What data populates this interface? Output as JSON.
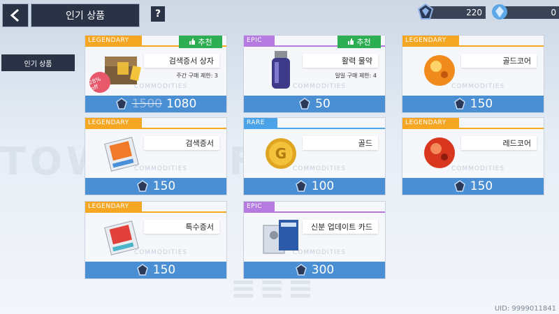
{
  "header": {
    "title": "인기 상품",
    "help_label": "?",
    "currency_1": {
      "value": "220",
      "icon": "blue-crystal-icon"
    },
    "currency_2": {
      "value": "0",
      "icon": "diamond-icon"
    }
  },
  "sidebar": {
    "items": [
      {
        "label": "인기 상품"
      }
    ]
  },
  "cards": [
    {
      "rarity": "LEGENDARY",
      "name": "검색증서 상자",
      "limit": "주간 구매 제한: 3",
      "old_price": "1500",
      "price": "1080",
      "badge": "추천",
      "sale": "28% off",
      "icon": "chest-icon"
    },
    {
      "rarity": "EPIC",
      "name": "활력 물약",
      "limit": "일일 구매 제한: 4",
      "price": "50",
      "badge": "추천",
      "icon": "potion-icon"
    },
    {
      "rarity": "LEGENDARY",
      "name": "골드코어",
      "price": "150",
      "icon": "gold-core-icon"
    },
    {
      "rarity": "LEGENDARY",
      "name": "검색증서",
      "price": "150",
      "icon": "certificate-icon"
    },
    {
      "rarity": "RARE",
      "name": "골드",
      "price": "100",
      "icon": "gold-coin-icon"
    },
    {
      "rarity": "LEGENDARY",
      "name": "레드코어",
      "price": "150",
      "icon": "red-core-icon"
    },
    {
      "rarity": "LEGENDARY",
      "name": "특수증서",
      "price": "150",
      "icon": "special-certificate-icon"
    },
    {
      "rarity": "EPIC",
      "name": "신분 업데이트 카드",
      "price": "300",
      "icon": "id-card-icon"
    }
  ],
  "card_watermark": "COMMODITIES",
  "uid": "UID: 9999011841",
  "colors": {
    "legendary": "#f5a623",
    "epic": "#b57be0",
    "rare": "#4aa3e8",
    "price_bar": "#4a8fd4",
    "recommend": "#2eae53"
  }
}
